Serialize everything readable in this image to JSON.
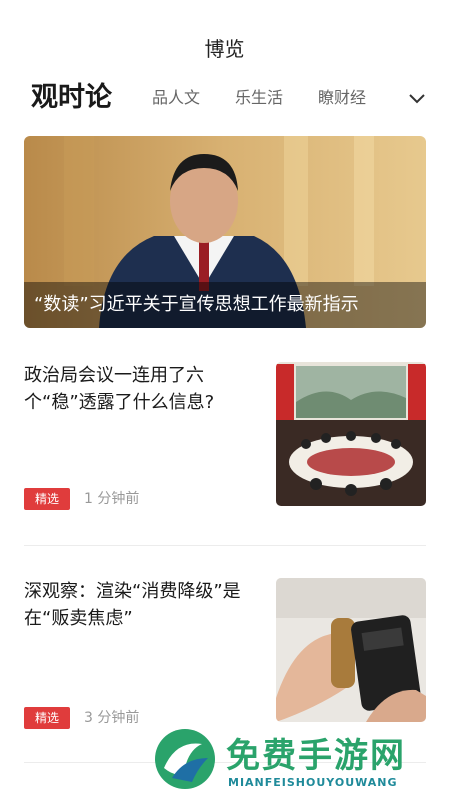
{
  "header": {
    "title": "博览"
  },
  "tabs": [
    {
      "label": "观时论",
      "active": true
    },
    {
      "label": "品人文",
      "active": false
    },
    {
      "label": "乐生活",
      "active": false
    },
    {
      "label": "瞭财经",
      "active": false
    }
  ],
  "hero": {
    "caption": "“数读”习近平关于宣传思想工作最新指示"
  },
  "articles": [
    {
      "title": "政治局会议一连用了六个“稳”透露了什么信息?",
      "tag": "精选",
      "time": "1 分钟前"
    },
    {
      "title": "深观察：渲染“消费降级”是在“贩卖焦虑”",
      "tag": "精选",
      "time": "3 分钟前"
    }
  ],
  "watermark": {
    "title": "免费手游网",
    "subtitle": "MIANFEISHOUYOUWANG"
  },
  "colors": {
    "tag_red": "#e03c3c",
    "watermark_green": "#2aa36b"
  },
  "icons": {
    "expand": "chevron-down-icon"
  }
}
